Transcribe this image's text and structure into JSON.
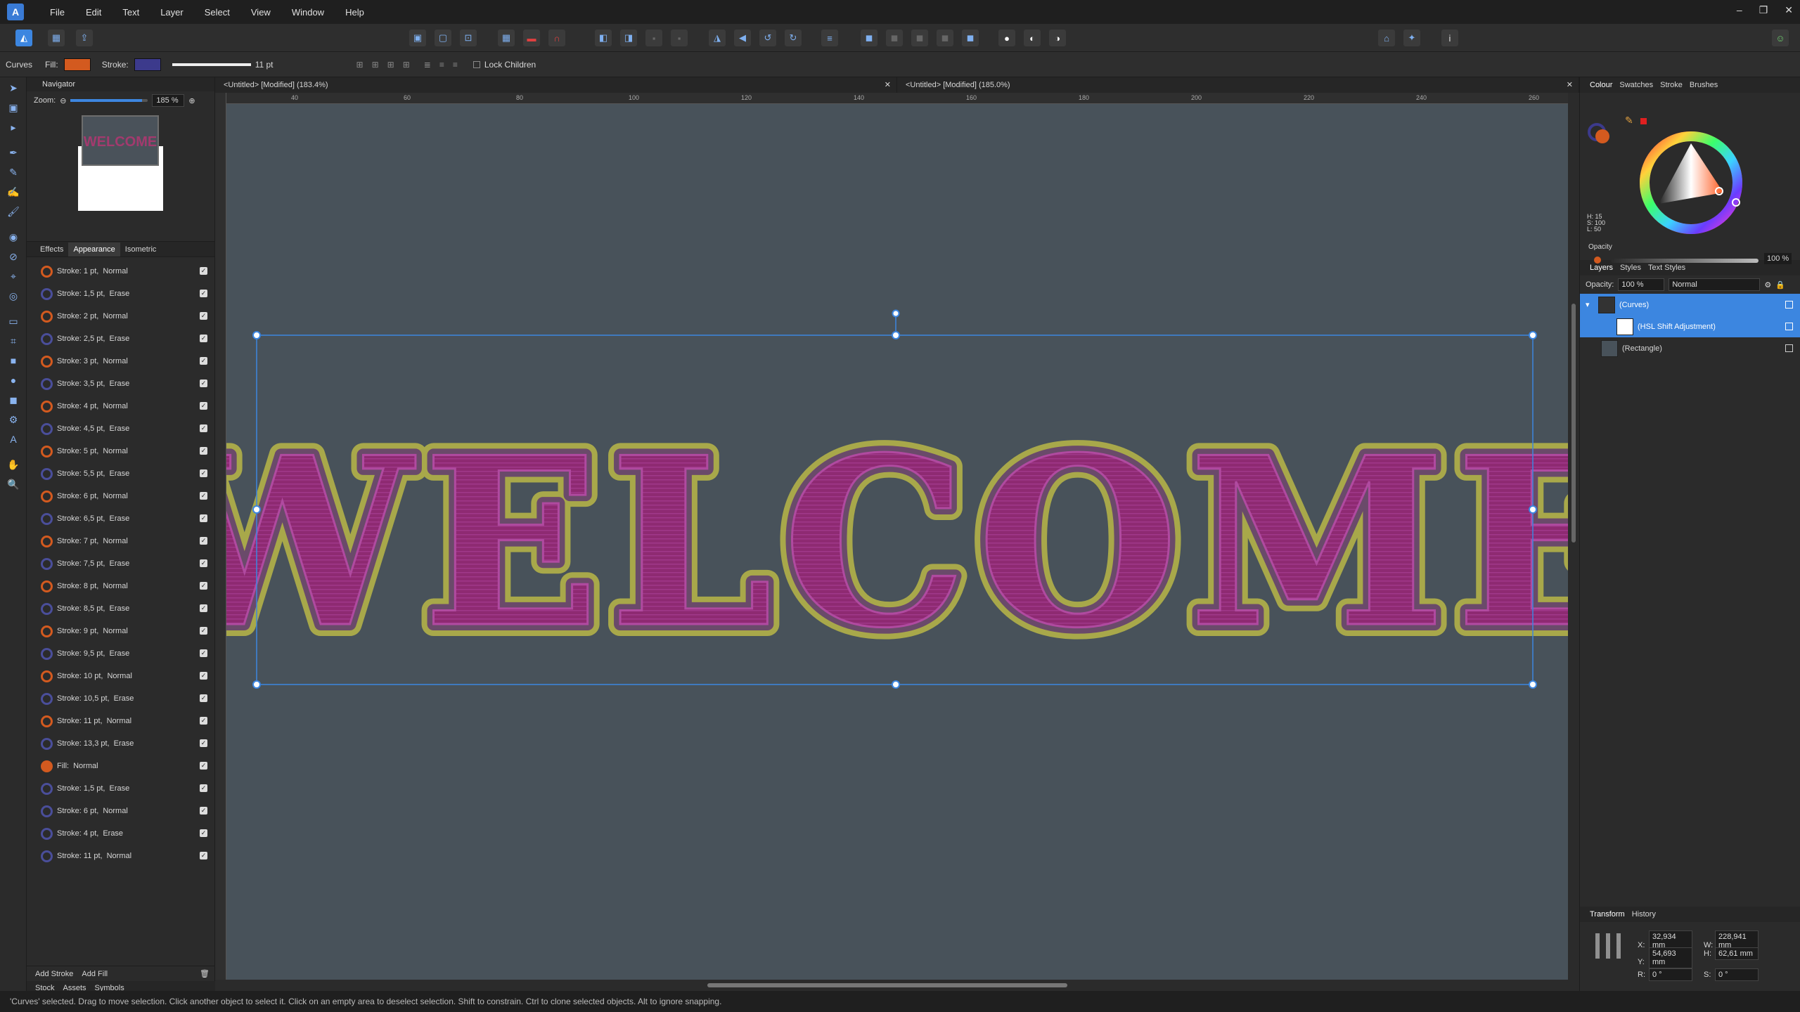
{
  "menu": {
    "items": [
      "File",
      "Edit",
      "Text",
      "Layer",
      "Select",
      "View",
      "Window",
      "Help"
    ]
  },
  "context": {
    "tool": "Curves",
    "fill_label": "Fill:",
    "stroke_label": "Stroke:",
    "stroke_width": "11 pt",
    "lock_children": "Lock Children",
    "fill_color": "#d35a1f",
    "stroke_color": "#3c3a8c"
  },
  "navigator": {
    "title": "Navigator",
    "zoom_label": "Zoom:",
    "zoom": "185 %",
    "zoom_fraction": 0.92,
    "thumb_text": "WELCOME"
  },
  "appearance": {
    "tabs": [
      "Effects",
      "Appearance",
      "Isometric"
    ],
    "rows": [
      {
        "label": "Stroke: 1 pt,",
        "mode": "Normal",
        "kind": "orange"
      },
      {
        "label": "Stroke: 1,5 pt,",
        "mode": "Erase",
        "kind": "blue"
      },
      {
        "label": "Stroke: 2 pt,",
        "mode": "Normal",
        "kind": "orange"
      },
      {
        "label": "Stroke: 2,5 pt,",
        "mode": "Erase",
        "kind": "blue"
      },
      {
        "label": "Stroke: 3 pt,",
        "mode": "Normal",
        "kind": "orange"
      },
      {
        "label": "Stroke: 3,5 pt,",
        "mode": "Erase",
        "kind": "blue"
      },
      {
        "label": "Stroke: 4 pt,",
        "mode": "Normal",
        "kind": "orange"
      },
      {
        "label": "Stroke: 4,5 pt,",
        "mode": "Erase",
        "kind": "blue"
      },
      {
        "label": "Stroke: 5 pt,",
        "mode": "Normal",
        "kind": "orange"
      },
      {
        "label": "Stroke: 5,5 pt,",
        "mode": "Erase",
        "kind": "blue"
      },
      {
        "label": "Stroke: 6 pt,",
        "mode": "Normal",
        "kind": "orange"
      },
      {
        "label": "Stroke: 6,5 pt,",
        "mode": "Erase",
        "kind": "blue"
      },
      {
        "label": "Stroke: 7 pt,",
        "mode": "Normal",
        "kind": "orange"
      },
      {
        "label": "Stroke: 7,5 pt,",
        "mode": "Erase",
        "kind": "blue"
      },
      {
        "label": "Stroke: 8 pt,",
        "mode": "Normal",
        "kind": "orange"
      },
      {
        "label": "Stroke: 8,5 pt,",
        "mode": "Erase",
        "kind": "blue"
      },
      {
        "label": "Stroke: 9 pt,",
        "mode": "Normal",
        "kind": "orange"
      },
      {
        "label": "Stroke: 9,5 pt,",
        "mode": "Erase",
        "kind": "blue"
      },
      {
        "label": "Stroke: 10 pt,",
        "mode": "Normal",
        "kind": "orange"
      },
      {
        "label": "Stroke: 10,5 pt,",
        "mode": "Erase",
        "kind": "blue"
      },
      {
        "label": "Stroke: 11 pt,",
        "mode": "Normal",
        "kind": "orange"
      },
      {
        "label": "Stroke: 13,3 pt,",
        "mode": "Erase",
        "kind": "blue"
      },
      {
        "label": "Fill:",
        "mode": "Normal",
        "kind": "fill"
      },
      {
        "label": "Stroke: 1,5 pt,",
        "mode": "Erase",
        "kind": "blue"
      },
      {
        "label": "Stroke: 6 pt,",
        "mode": "Normal",
        "kind": "blue"
      },
      {
        "label": "Stroke: 4 pt,",
        "mode": "Erase",
        "kind": "blue"
      },
      {
        "label": "Stroke: 11 pt,",
        "mode": "Normal",
        "kind": "blue"
      }
    ],
    "add_stroke": "Add Stroke",
    "add_fill": "Add Fill",
    "bottom_tabs": [
      "Stock",
      "Assets",
      "Symbols"
    ]
  },
  "documents": [
    {
      "title": "<Untitled> [Modified] (183.4%)"
    },
    {
      "title": "<Untitled> [Modified] (185.0%)"
    }
  ],
  "ruler": {
    "h_labels": [
      "40",
      "60",
      "80",
      "100",
      "120",
      "140",
      "160",
      "180",
      "200",
      "220",
      "240",
      "260"
    ]
  },
  "artwork": {
    "text": "WELCOME",
    "fill": "#8e2a72",
    "outline": "#a8a84a"
  },
  "colour": {
    "tabs": [
      "Colour",
      "Swatches",
      "Stroke",
      "Brushes"
    ],
    "h": "H: 15",
    "s": "S: 100",
    "l": "L: 50",
    "opacity_label": "Opacity",
    "opacity": "100 %"
  },
  "layers": {
    "tabs": [
      "Layers",
      "Styles",
      "Text Styles"
    ],
    "opacity_label": "Opacity:",
    "opacity": "100 %",
    "blend": "Normal",
    "items": [
      {
        "name": "(Curves)",
        "selected": true
      },
      {
        "name": "(HSL Shift Adjustment)",
        "selected": true
      },
      {
        "name": "(Rectangle)",
        "selected": false
      }
    ]
  },
  "transform": {
    "tabs": [
      "Transform",
      "History"
    ],
    "x": "32,934 mm",
    "y": "54,693 mm",
    "w": "228,941 mm",
    "h": "62,61 mm",
    "r": "0 °",
    "s": "0 °"
  },
  "status": {
    "text": "'Curves' selected. Drag to move selection. Click another object to select it. Click on an empty area to deselect selection. Shift to constrain. Ctrl to clone selected objects. Alt to ignore snapping."
  }
}
